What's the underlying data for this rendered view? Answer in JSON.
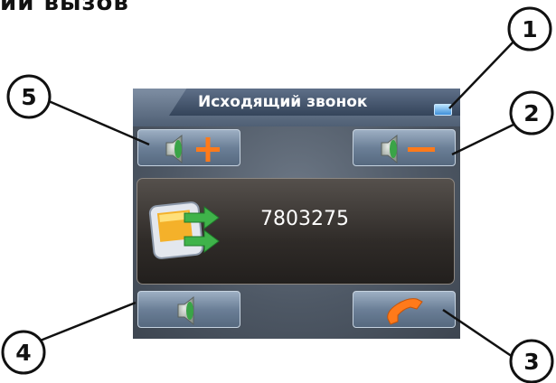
{
  "doc": {
    "heading": "ий вызов"
  },
  "window": {
    "title": "Исходящий звонок"
  },
  "call": {
    "number": "7803275"
  },
  "callouts": [
    "1",
    "2",
    "3",
    "4",
    "5"
  ],
  "icons": {
    "minimize": "minimize-icon",
    "volume_up": "speaker-plus-icon",
    "volume_down": "speaker-minus-icon",
    "mute": "speaker-icon",
    "hangup": "handset-icon",
    "device": "pda-outgoing-call-icon"
  },
  "colors": {
    "accent": "#ff7a1a",
    "green": "#3fb34a",
    "title_bar": "#4f5f74"
  }
}
